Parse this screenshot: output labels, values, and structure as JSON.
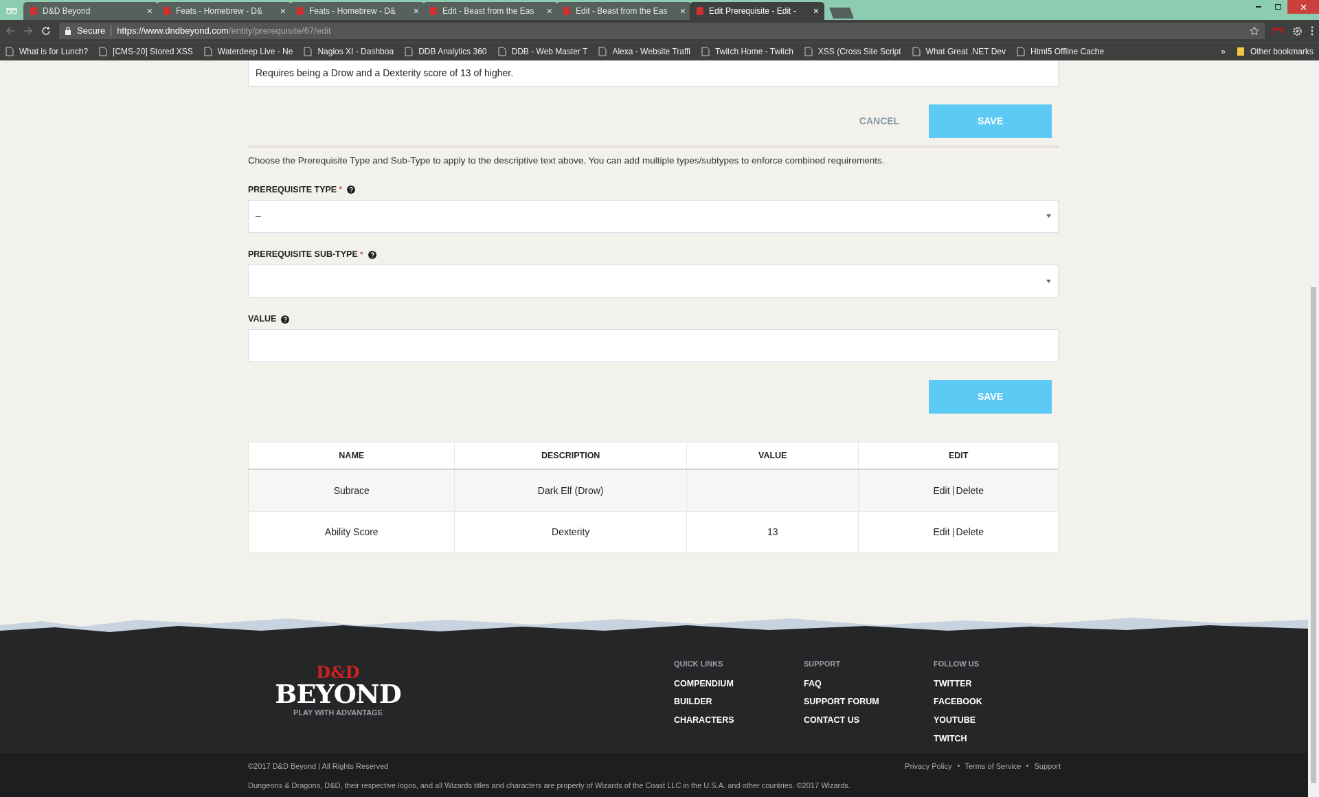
{
  "browser": {
    "tabs": [
      {
        "title": "D&D Beyond",
        "selected": false
      },
      {
        "title": "Feats - Homebrew - D&",
        "selected": false
      },
      {
        "title": "Feats - Homebrew - D&",
        "selected": false
      },
      {
        "title": "Edit - Beast from the Eas",
        "selected": false
      },
      {
        "title": "Edit - Beast from the Eas",
        "selected": false
      },
      {
        "title": "Edit Prerequisite - Edit -",
        "selected": true
      }
    ],
    "close_glyph": "×",
    "secure_label": "Secure",
    "url_host": "https://www.dndbeyond.com",
    "url_path": "/entity/prerequisite/67/edit",
    "bookmarks": [
      {
        "label": "What is for Lunch?"
      },
      {
        "label": "[CMS-20] Stored XSS"
      },
      {
        "label": "Waterdeep Live - Ne"
      },
      {
        "label": "Nagios XI - Dashboa"
      },
      {
        "label": "DDB Analytics 360"
      },
      {
        "label": "DDB - Web Master T"
      },
      {
        "label": "Alexa - Website Traffi"
      },
      {
        "label": "Twitch Home - Twitch"
      },
      {
        "label": "XSS (Cross Site Script"
      },
      {
        "label": "What Great .NET Dev"
      },
      {
        "label": "Html5 Offline Cache"
      }
    ],
    "more_label": "»",
    "other_bookmarks": "Other bookmarks"
  },
  "form": {
    "description_value": "Requires being a Drow and a Dexterity score of 13 of higher.",
    "cancel": "CANCEL",
    "save": "SAVE",
    "help_text": "Choose the Prerequisite Type and Sub-Type to apply to the descriptive text above. You can add multiple types/subtypes to enforce combined requirements.",
    "fields": [
      {
        "label": "PREREQUISITE TYPE",
        "required": true,
        "kind": "select",
        "value": "–"
      },
      {
        "label": "PREREQUISITE SUB-TYPE",
        "required": true,
        "kind": "select"
      },
      {
        "label": "VALUE",
        "required": false,
        "kind": "text"
      }
    ],
    "required_mark": "*",
    "save_bottom": "SAVE"
  },
  "table": {
    "columns": [
      "NAME",
      "DESCRIPTION",
      "VALUE",
      "EDIT"
    ],
    "rows": [
      {
        "name": "Subrace",
        "description": "Dark Elf (Drow)",
        "edit": "Edit",
        "delete": "Delete"
      },
      {
        "name": "Ability Score",
        "description": "Dexterity",
        "value": "13",
        "edit": "Edit",
        "delete": "Delete"
      }
    ]
  },
  "footer": {
    "logo_top": "D&D",
    "logo_main": "BEYOND",
    "tagline": "PLAY WITH ADVANTAGE",
    "columns": [
      {
        "heading": "QUICK LINKS",
        "links": [
          "COMPENDIUM",
          "BUILDER",
          "CHARACTERS"
        ]
      },
      {
        "heading": "SUPPORT",
        "links": [
          "FAQ",
          "SUPPORT FORUM",
          "CONTACT US"
        ]
      },
      {
        "heading": "FOLLOW US",
        "links": [
          "TWITTER",
          "FACEBOOK",
          "YOUTUBE",
          "TWITCH"
        ]
      }
    ],
    "copyright": "©2017 D&D Beyond | All Rights Reserved",
    "legal": "Dungeons & Dragons, D&D, their respective logos, and all Wizards titles and characters are property of Wizards of the Coast LLC in the U.S.A. and other countries. ©2017 Wizards.",
    "bottom_links": [
      "Privacy Policy",
      "Terms of Service",
      "Support"
    ]
  }
}
